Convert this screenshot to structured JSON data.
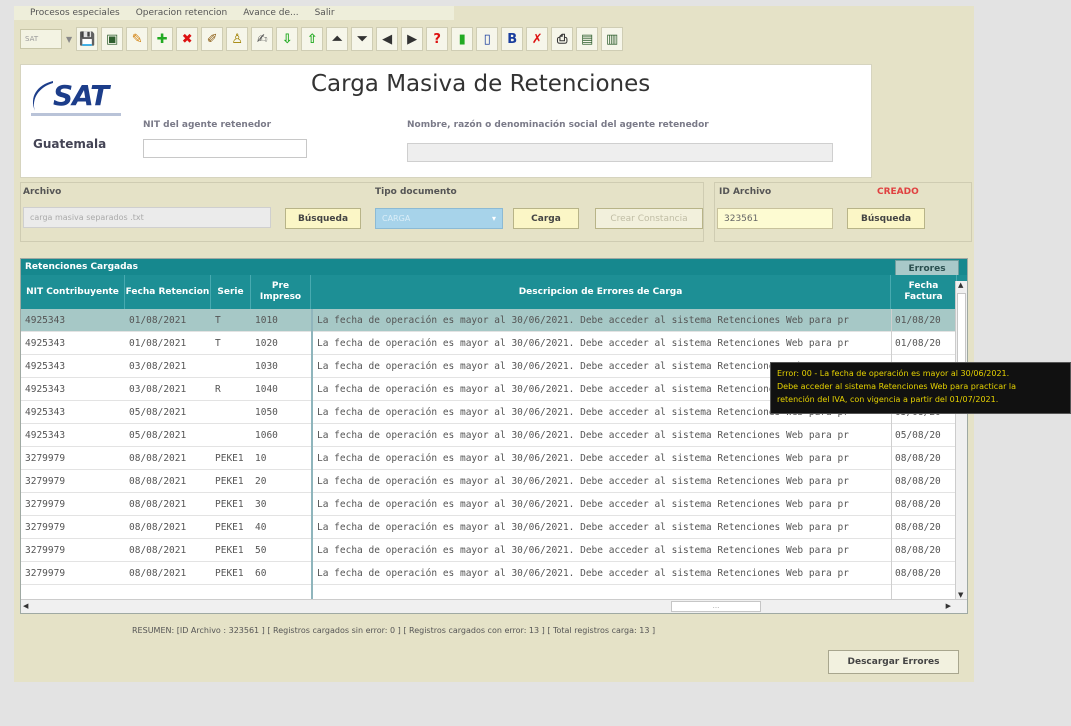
{
  "menu": [
    "Procesos especiales",
    "Operacion retencion",
    "Avance de...",
    "Salir"
  ],
  "toolbar": {
    "combo_value": "SAT",
    "icons": [
      {
        "name": "save-icon",
        "glyph": "💾",
        "color": "#1a3e9e"
      },
      {
        "name": "monitor-icon",
        "glyph": "▣",
        "color": "#2f5f2f"
      },
      {
        "name": "edit-icon",
        "glyph": "✎",
        "color": "#d07a00"
      },
      {
        "name": "add-icon",
        "glyph": "✚",
        "color": "#22aa22"
      },
      {
        "name": "delete-icon",
        "glyph": "✖",
        "color": "#dd1111"
      },
      {
        "name": "pencil-icon",
        "glyph": "✐",
        "color": "#8a5a10"
      },
      {
        "name": "user-icon",
        "glyph": "♙",
        "color": "#a08000"
      },
      {
        "name": "write-icon",
        "glyph": "✍",
        "color": "#555555"
      },
      {
        "name": "arrow-down-icon",
        "glyph": "⇩",
        "color": "#22aa22"
      },
      {
        "name": "arrow-up-icon",
        "glyph": "⇧",
        "color": "#22aa22"
      },
      {
        "name": "first-icon",
        "glyph": "⏶",
        "color": "#333333"
      },
      {
        "name": "last-icon",
        "glyph": "⏷",
        "color": "#333333"
      },
      {
        "name": "previous-icon",
        "glyph": "◀",
        "color": "#333333"
      },
      {
        "name": "next-icon",
        "glyph": "▶",
        "color": "#333333"
      },
      {
        "name": "help-icon",
        "glyph": "?",
        "color": "#dd1111"
      },
      {
        "name": "book-icon",
        "glyph": "▮",
        "color": "#22aa22"
      },
      {
        "name": "document-icon",
        "glyph": "▯",
        "color": "#1a3e9e"
      },
      {
        "name": "document-b-icon",
        "glyph": "B",
        "color": "#1a3e9e"
      },
      {
        "name": "excel-icon",
        "glyph": "✗",
        "color": "#dd1111"
      },
      {
        "name": "print-icon",
        "glyph": "⎙",
        "color": "#333333"
      },
      {
        "name": "screen-icon",
        "glyph": "▤",
        "color": "#2f5f2f"
      },
      {
        "name": "screen-alt-icon",
        "glyph": "▥",
        "color": "#2f5f2f"
      }
    ]
  },
  "header": {
    "logo_text": "SAT",
    "country": "Guatemala",
    "title": "Carga Masiva de Retenciones",
    "nit_label": "NIT del agente retenedor",
    "nit_value": "",
    "name_label": "Nombre, razón o denominación social del agente retenedor",
    "name_value": ""
  },
  "archivo": {
    "label": "Archivo",
    "value": "carga masiva separados .txt",
    "search_button": "Búsqueda",
    "tipo_label": "Tipo documento",
    "tipo_value": "CARGA",
    "load_button": "Carga",
    "create_button": "Crear Constancia"
  },
  "id_archivo": {
    "label": "ID Archivo",
    "status": "CREADO",
    "value": "323561",
    "search_button": "Búsqueda"
  },
  "grid": {
    "title": "Retenciones Cargadas",
    "errors_tab": "Errores",
    "columns": [
      "NIT Contribuyente",
      "Fecha Retencion",
      "Serie",
      "Pre Impreso",
      "Descripcion de Errores de Carga",
      "Fecha Factura"
    ],
    "rows": [
      [
        "4925343",
        "01/08/2021",
        "T",
        "1010",
        "La fecha de operación es mayor al 30/06/2021. Debe acceder al sistema Retenciones Web para pr",
        "01/08/20"
      ],
      [
        "4925343",
        "01/08/2021",
        "T",
        "1020",
        "La fecha de operación es mayor al 30/06/2021. Debe acceder al sistema Retenciones Web para pr",
        "01/08/20"
      ],
      [
        "4925343",
        "03/08/2021",
        "",
        "1030",
        "La fecha de operación es mayor al 30/06/2021. Debe acceder al sistema Retenciones Web para pr",
        "03/08/20"
      ],
      [
        "4925343",
        "03/08/2021",
        "R",
        "1040",
        "La fecha de operación es mayor al 30/06/2021. Debe acceder al sistema Retenciones Web para pr",
        "03/08/20"
      ],
      [
        "4925343",
        "05/08/2021",
        "",
        "1050",
        "La fecha de operación es mayor al 30/06/2021. Debe acceder al sistema Retenciones Web para pr",
        "05/08/20"
      ],
      [
        "4925343",
        "05/08/2021",
        "",
        "1060",
        "La fecha de operación es mayor al 30/06/2021. Debe acceder al sistema Retenciones Web para pr",
        "05/08/20"
      ],
      [
        "3279979",
        "08/08/2021",
        "PEKE1",
        "10",
        "La fecha de operación es mayor al 30/06/2021. Debe acceder al sistema Retenciones Web para pr",
        "08/08/20"
      ],
      [
        "3279979",
        "08/08/2021",
        "PEKE1",
        "20",
        "La fecha de operación es mayor al 30/06/2021. Debe acceder al sistema Retenciones Web para pr",
        "08/08/20"
      ],
      [
        "3279979",
        "08/08/2021",
        "PEKE1",
        "30",
        "La fecha de operación es mayor al 30/06/2021. Debe acceder al sistema Retenciones Web para pr",
        "08/08/20"
      ],
      [
        "3279979",
        "08/08/2021",
        "PEKE1",
        "40",
        "La fecha de operación es mayor al 30/06/2021. Debe acceder al sistema Retenciones Web para pr",
        "08/08/20"
      ],
      [
        "3279979",
        "08/08/2021",
        "PEKE1",
        "50",
        "La fecha de operación es mayor al 30/06/2021. Debe acceder al sistema Retenciones Web para pr",
        "08/08/20"
      ],
      [
        "3279979",
        "08/08/2021",
        "PEKE1",
        "60",
        "La fecha de operación es mayor al 30/06/2021. Debe acceder al sistema Retenciones Web para pr",
        "08/08/20"
      ]
    ],
    "hscroll_label": "..."
  },
  "tooltip": {
    "line1": "Error: 00 - La fecha de operación es mayor al 30/06/2021.",
    "line2": "Debe acceder al sistema Retenciones Web para practicar la",
    "line3": "retención del IVA, con vigencia a partir del 01/07/2021."
  },
  "summary": "RESUMEN: [ID Archivo : 323561 ] [ Registros cargados sin error: 0 ]  [ Registros cargados con error: 13 ] [  Total registros carga: 13 ]",
  "download_button": "Descargar Errores"
}
